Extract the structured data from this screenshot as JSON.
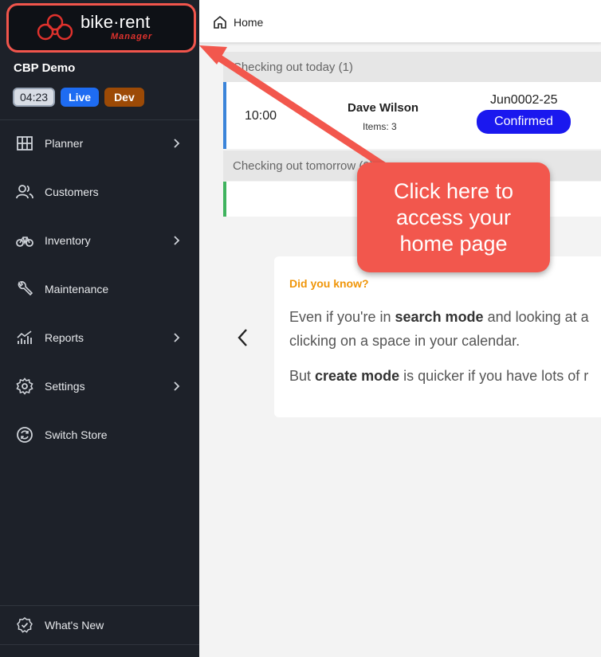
{
  "sidebar": {
    "logo": {
      "brand": "bike·rent",
      "sub": "Manager"
    },
    "store_name": "CBP Demo",
    "badges": {
      "time": "04:23",
      "live": "Live",
      "dev": "Dev"
    },
    "items": [
      {
        "label": "Planner",
        "icon": "grid-icon",
        "has_submenu": true
      },
      {
        "label": "Customers",
        "icon": "users-icon",
        "has_submenu": false
      },
      {
        "label": "Inventory",
        "icon": "bicycle-icon",
        "has_submenu": true
      },
      {
        "label": "Maintenance",
        "icon": "wrench-icon",
        "has_submenu": false
      },
      {
        "label": "Reports",
        "icon": "chart-icon",
        "has_submenu": true
      },
      {
        "label": "Settings",
        "icon": "gear-icon",
        "has_submenu": true
      },
      {
        "label": "Switch Store",
        "icon": "switch-icon",
        "has_submenu": false
      }
    ],
    "whats_new": "What's New"
  },
  "header": {
    "breadcrumb": "Home"
  },
  "today": {
    "title": "Checking out today (1)",
    "booking": {
      "time": "10:00",
      "customer": "Dave Wilson",
      "items": "Items: 3",
      "ref": "Jun0002-25",
      "status": "Confirmed"
    }
  },
  "tomorrow": {
    "title": "Checking out tomorrow (0)"
  },
  "tip": {
    "title": "Did you know?",
    "line1": {
      "pre": "Even if you're in ",
      "bold": "search mode",
      "post": " and looking at a"
    },
    "line2": "clicking on a space in your calendar.",
    "line3": {
      "pre": "But ",
      "bold": "create mode",
      "post": " is quicker if you have lots of r"
    }
  },
  "callout": {
    "text": "Click here to access your home page"
  },
  "colors": {
    "sidebar": "#1d2129",
    "accent": "#f2574d",
    "live": "#1e6cf2",
    "dev": "#9c4a06",
    "confirmed": "#1a18ef",
    "tip_title": "#f0960a"
  }
}
